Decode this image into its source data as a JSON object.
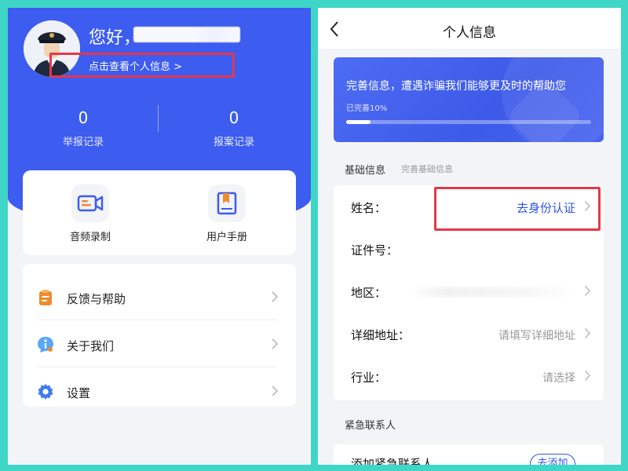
{
  "left": {
    "greeting": "您好，",
    "view_info_link": "点击查看个人信息 >",
    "stats": [
      {
        "value": "0",
        "label": "举报记录"
      },
      {
        "value": "0",
        "label": "报案记录"
      }
    ],
    "quick_actions": [
      {
        "label": "音频录制",
        "icon": "video-camera-icon"
      },
      {
        "label": "用户手册",
        "icon": "bookmark-book-icon"
      }
    ],
    "menu": [
      {
        "label": "反馈与帮助",
        "icon": "clipboard-icon"
      },
      {
        "label": "关于我们",
        "icon": "info-chat-icon"
      },
      {
        "label": "设置",
        "icon": "gear-icon"
      }
    ]
  },
  "right": {
    "nav_title": "个人信息",
    "banner": {
      "text": "完善信息，遭遇诈骗我们能够更及时的帮助您",
      "progress_label": "已完善10%",
      "progress": 0.1
    },
    "basic_section": {
      "title": "基础信息",
      "hint": "完善基础信息"
    },
    "form": [
      {
        "label": "姓名：",
        "value": "去身份认证",
        "style": "link",
        "chevron": true
      },
      {
        "label": "证件号：",
        "value": "",
        "style": "plain",
        "chevron": false
      },
      {
        "label": "地区：",
        "value": "",
        "style": "blurred",
        "chevron": true
      },
      {
        "label": "详细地址：",
        "value": "请填写详细地址",
        "style": "placeholder",
        "chevron": true
      },
      {
        "label": "行业：",
        "value": "请选择",
        "style": "placeholder",
        "chevron": true
      }
    ],
    "emergency_section": {
      "title": "紧急联系人"
    },
    "emergency_row": {
      "label": "添加紧急联系人",
      "button": "去添加"
    }
  },
  "colors": {
    "brand_blue": "#3d5cf0",
    "link_blue": "#2c54e8",
    "highlight_red": "#e5374a",
    "frame_teal": "#3fd6c8"
  }
}
